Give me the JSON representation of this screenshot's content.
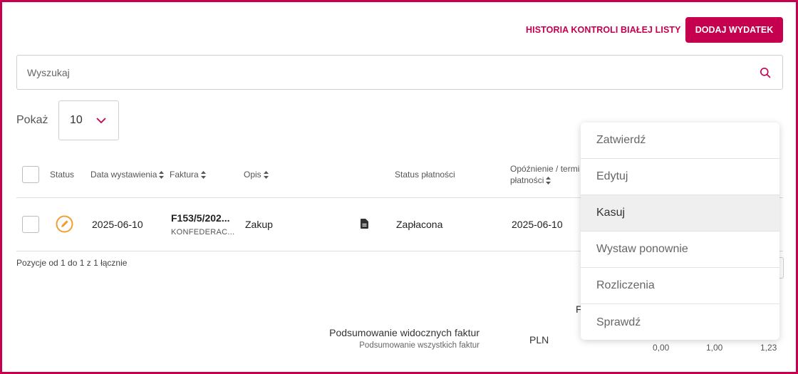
{
  "header": {
    "history_link": "HISTORIA KONTROLI BIAŁEJ LISTY",
    "add_button": "DODAJ WYDATEK"
  },
  "search": {
    "placeholder": "Wyszukaj"
  },
  "page_size": {
    "label": "Pokaż",
    "value": "10"
  },
  "table": {
    "columns": {
      "status": "Status",
      "issue_date": "Data wystawienia",
      "invoice": "Faktura",
      "description": "Opis",
      "payment_status": "Status płatności",
      "delay_line1": "Opóźnienie / termi",
      "delay_line2": "płatności"
    },
    "rows": [
      {
        "issue_date": "2025-06-10",
        "invoice_number": "F153/5/202...",
        "invoice_contractor": "KONFEDERAC...",
        "description": "Zakup",
        "payment_status": "Zapłacona",
        "due_date": "2025-06-10",
        "status_icon": "pencil-icon"
      }
    ]
  },
  "pagination": {
    "info": "Pozycje od 1 do 1 z 1 łącznie"
  },
  "summary": {
    "visible_label": "Podsumowanie widocznych faktur",
    "all_label": "Podsumowanie wszystkich faktur",
    "currency": "PLN",
    "values": [
      "0,00",
      "1,00",
      "1,23"
    ],
    "peek_letter": "F"
  },
  "context_menu": {
    "items": [
      "Zatwierdź",
      "Edytuj",
      "Kasuj",
      "Wystaw ponownie",
      "Rozliczenia",
      "Sprawdź"
    ],
    "highlighted": "Kasuj"
  },
  "colors": {
    "accent": "#c4004f",
    "status_icon": "#f0a030"
  }
}
